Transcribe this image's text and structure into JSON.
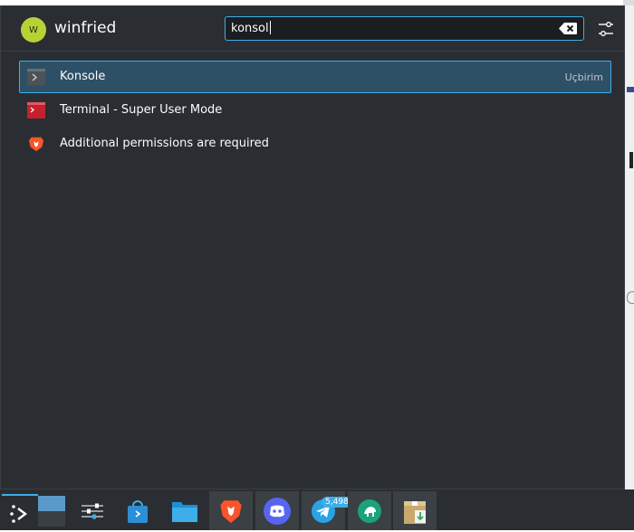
{
  "user": {
    "avatar_letter": "W",
    "name": "winfried"
  },
  "search": {
    "value": "konsol"
  },
  "results": [
    {
      "label": "Konsole",
      "category": "Uçbirim",
      "icon": "konsole-icon",
      "selected": true
    },
    {
      "label": "Terminal - Super User Mode",
      "category": "",
      "icon": "terminal-su-icon",
      "selected": false
    },
    {
      "label": "Additional permissions are required",
      "category": "",
      "icon": "brave-icon",
      "selected": false
    }
  ],
  "taskbar": {
    "items": [
      {
        "name": "application-launcher",
        "icon": "launcher-icon"
      },
      {
        "name": "pager",
        "icon": "desktop-pager-icon"
      },
      {
        "name": "settings",
        "icon": "sliders-icon"
      },
      {
        "name": "discover",
        "icon": "store-bag-icon"
      },
      {
        "name": "files",
        "icon": "folder-icon"
      },
      {
        "name": "brave",
        "icon": "brave-icon"
      },
      {
        "name": "discord",
        "icon": "discord-icon"
      },
      {
        "name": "telegram",
        "icon": "telegram-icon"
      },
      {
        "name": "mattermost",
        "icon": "mattermost-icon"
      },
      {
        "name": "installer",
        "icon": "package-install-icon"
      }
    ],
    "telegram_badge": "5,498"
  },
  "colors": {
    "panel_bg": "#2a2e32",
    "accent": "#3daee9",
    "selection_bg": "#2e5066",
    "avatar": "#b5d334",
    "text": "#fcfcfc"
  }
}
